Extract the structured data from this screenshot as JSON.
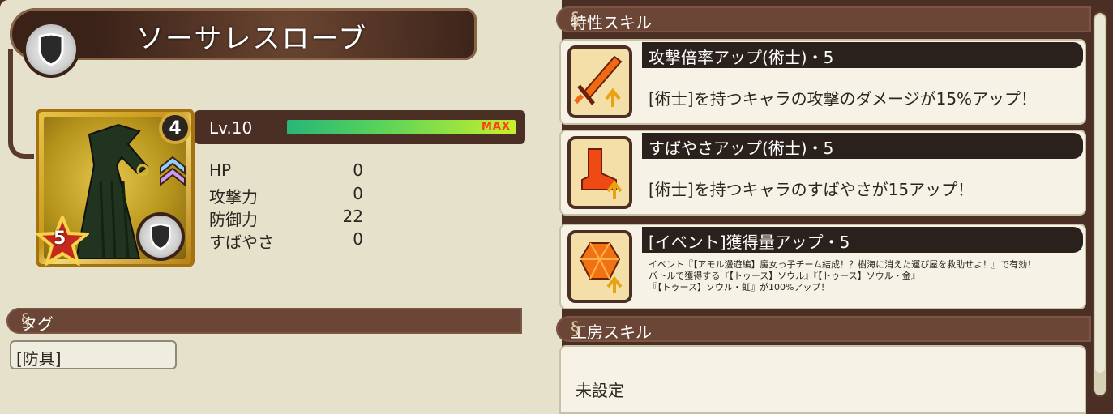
{
  "item": {
    "name": "ソーサレスローブ",
    "level_label": "Lv.10",
    "exp_max_label": "MAX",
    "exp_progress": 1.0,
    "level_badge": "4",
    "rarity": "5",
    "stats": [
      {
        "label": "HP",
        "value": "0"
      },
      {
        "label": "攻撃力",
        "value": "0"
      },
      {
        "label": "防御力",
        "value": "22"
      },
      {
        "label": "すばやさ",
        "value": "0"
      }
    ]
  },
  "tags": {
    "header": "タグ",
    "items": [
      "[防具]"
    ]
  },
  "traits": {
    "header": "特性スキル",
    "skills": [
      {
        "title": "攻撃倍率アップ(術士)・5",
        "desc": "[術士]を持つキャラの攻撃のダメージが15%アップ！",
        "icon": "sword-up-icon"
      },
      {
        "title": "すばやさアップ(術士)・5",
        "desc": "[術士]を持つキャラのすばやさが15アップ！",
        "icon": "boot-up-icon"
      },
      {
        "title": "[イベント]獲得量アップ・5",
        "desc_lines": [
          "イベント『【アモル漫遊編】魔女っ子チーム結成！？樹海に消えた運び屋を救助せよ！』で有効！",
          "バトルで獲得する『【トゥース】ソウル』『【トゥース】ソウル・金』",
          "『【トゥース】ソウル・虹』が100%アップ！"
        ],
        "icon": "gem-up-icon"
      }
    ]
  },
  "workshop": {
    "header": "工房スキル",
    "value": "未設定"
  },
  "colors": {
    "background": "#4b2f25",
    "panel": "#e6e1ca",
    "header": "#6b4536",
    "title_bar": "#2b211c",
    "exp_max": "#ff3b1b"
  }
}
